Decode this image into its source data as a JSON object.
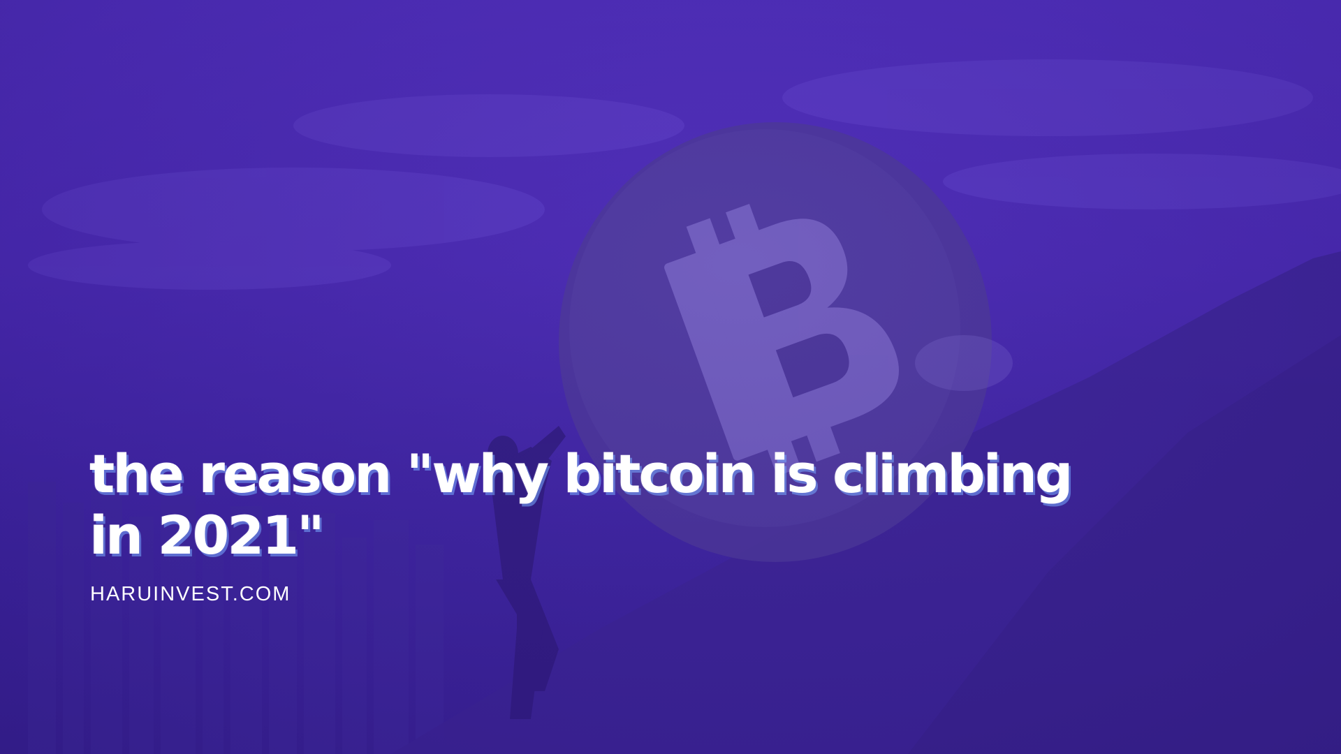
{
  "banner": {
    "headline": "the reason \"why bitcoin is climbing in 2021\"",
    "site_label": "HARUINVEST.COM"
  },
  "background": {
    "description_icons": [
      "boulder-with-bitcoin-symbol-icon",
      "person-pushing-icon",
      "hillside-icon",
      "city-skyline-icon"
    ],
    "overlay_color": "#4a2ab0"
  }
}
